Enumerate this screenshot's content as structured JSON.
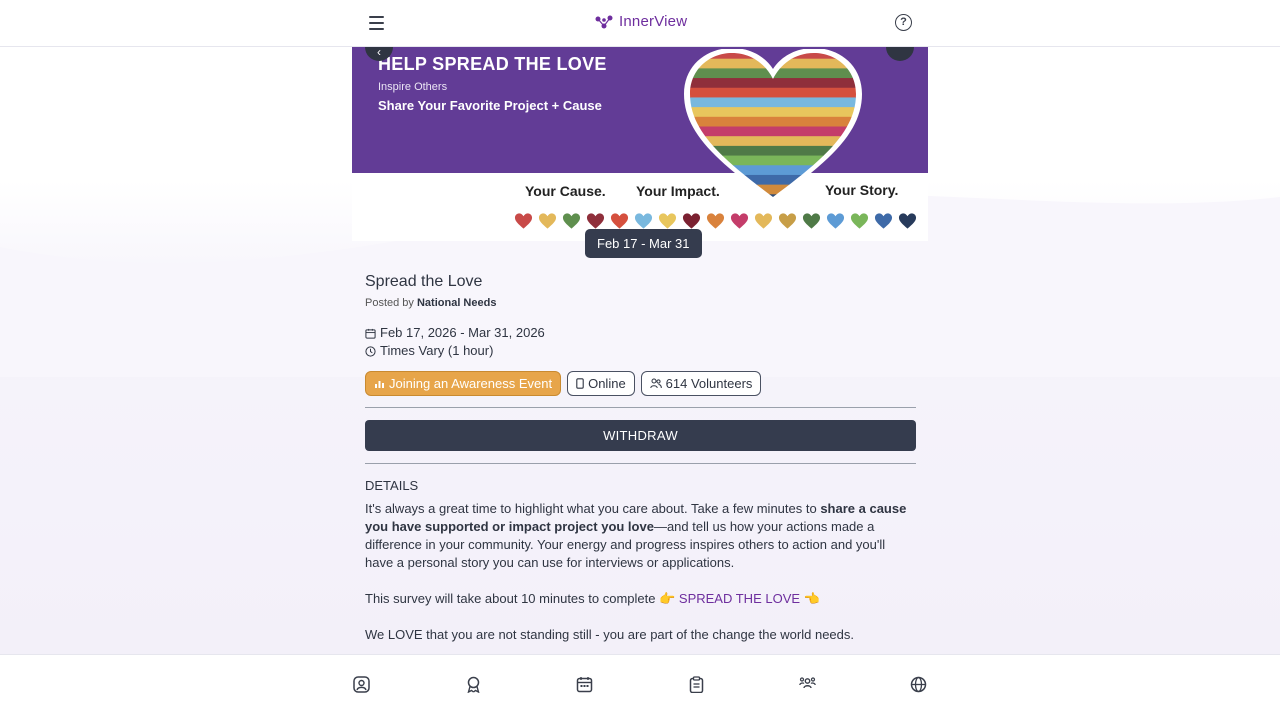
{
  "header": {
    "brand_name": "InnerView",
    "menu_icon": "hamburger-icon",
    "help_icon": "help-circle-icon",
    "help_glyph": "?"
  },
  "banner": {
    "title": "HELP SPREAD THE LOVE",
    "subtitle": "Inspire Others",
    "tagline": "Share Your Favorite Project + Cause",
    "cause": "Your Cause.",
    "impact": "Your Impact.",
    "story": "Your Story.",
    "back_glyph": "‹",
    "heart_colors": [
      "#c84a48",
      "#e3b85a",
      "#5f8f4e",
      "#8f2f3b",
      "#d5503e",
      "#79b8de",
      "#e8c65d",
      "#7b2131",
      "#d9823c",
      "#c43d6a",
      "#e3b85a",
      "#c79e47",
      "#4f7a47",
      "#5d9bd5",
      "#7ab65a",
      "#3e6aa8",
      "#273a5b"
    ]
  },
  "date_pill": "Feb 17 - Mar 31",
  "event": {
    "title": "Spread the Love",
    "posted_prefix": "Posted by",
    "posted_by": "National Needs",
    "date_range": "Feb 17, 2026 - Mar 31, 2026",
    "times": "Times Vary (1 hour)"
  },
  "chips": {
    "category": "Joining an Awareness Event",
    "mode": "Online",
    "volunteers": "614 Volunteers"
  },
  "withdraw_label": "WITHDRAW",
  "details": {
    "heading": "DETAILS",
    "p1_start": "It's always a great time to highlight what you care about. Take a few minutes to ",
    "p1_bold": "share a cause you have supported or impact project you love",
    "p1_end": "—and tell us how your actions made a difference in your community. Your energy and progress inspires others to action and you'll have a personal story you can use for interviews or applications.",
    "p2_start": "This survey will take about 10 minutes to complete ",
    "p2_emoji_left": "👉",
    "p2_link": "SPREAD THE LOVE",
    "p2_emoji_right": "👈",
    "p3": "We LOVE that you are not standing still - you are part of the change the world needs."
  },
  "bottom_nav": [
    "profile-icon",
    "badge-icon",
    "calendar-icon",
    "clipboard-icon",
    "people-icon",
    "globe-icon"
  ]
}
